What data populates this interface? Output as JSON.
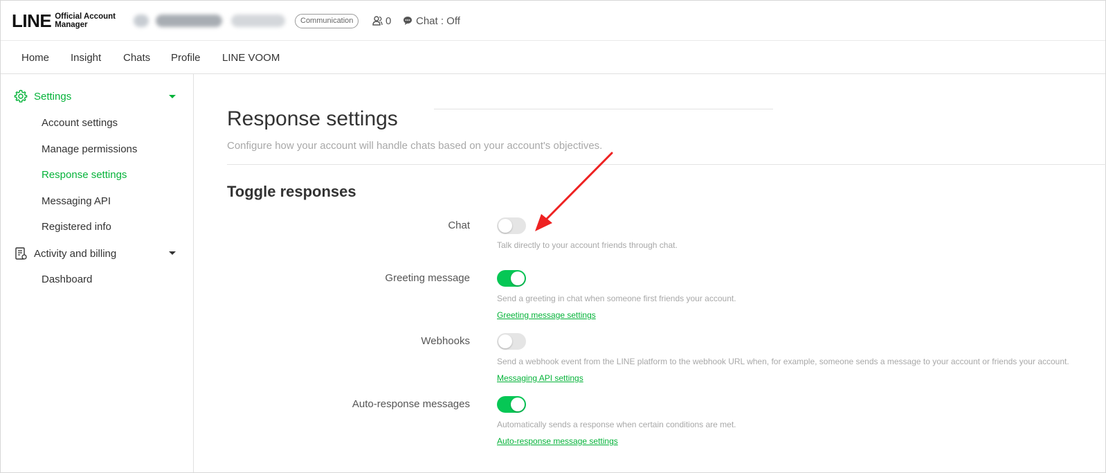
{
  "header": {
    "logo_main": "LINE",
    "logo_sub_1": "Official Account",
    "logo_sub_2": "Manager",
    "plan_badge": "Communication",
    "friends_count": "0",
    "chat_status": "Chat : Off"
  },
  "nav": {
    "tabs": [
      "Home",
      "Insight",
      "Chats",
      "Profile",
      "LINE VOOM"
    ]
  },
  "sidebar": {
    "settings_label": "Settings",
    "settings_items": [
      "Account settings",
      "Manage permissions",
      "Response settings",
      "Messaging API",
      "Registered info"
    ],
    "billing_label": "Activity and billing",
    "billing_items": [
      "Dashboard"
    ]
  },
  "page": {
    "title": "Response settings",
    "subtitle": "Configure how your account will handle chats based on your account's objectives.",
    "section_title": "Toggle responses"
  },
  "toggles": [
    {
      "label": "Chat",
      "on": false,
      "description": "Talk directly to your account friends through chat.",
      "link": ""
    },
    {
      "label": "Greeting message",
      "on": true,
      "description": "Send a greeting in chat when someone first friends your account.",
      "link": "Greeting message settings"
    },
    {
      "label": "Webhooks",
      "on": false,
      "description": "Send a webhook event from the LINE platform to the webhook URL when, for example, someone sends a message to your account or friends your account.",
      "link": "Messaging API settings"
    },
    {
      "label": "Auto-response messages",
      "on": true,
      "description": "Automatically sends a response when certain conditions are met.",
      "link": "Auto-response message settings"
    }
  ],
  "colors": {
    "accent": "#06b33a",
    "toggle_on": "#06c755",
    "toggle_off": "#e5e5e5",
    "annotation": "#ee2222"
  }
}
